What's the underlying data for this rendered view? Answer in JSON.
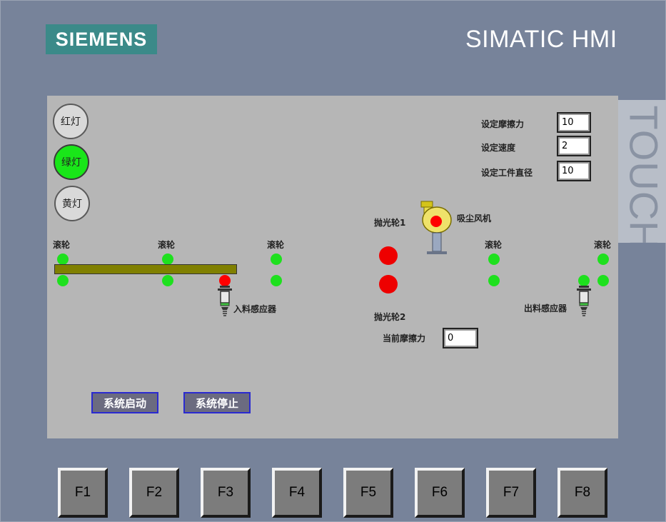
{
  "brand": {
    "logo": "SIEMENS",
    "title": "SIMATIC HMI",
    "touch": "TOUCH"
  },
  "lamps": {
    "red": "红灯",
    "green": "绿灯",
    "yellow": "黄灯"
  },
  "settings": {
    "friction_label": "设定摩擦力",
    "friction_value": "10",
    "speed_label": "设定速度",
    "speed_value": "2",
    "diameter_label": "设定工件直径",
    "diameter_value": "10"
  },
  "process": {
    "roller_label": "滚轮",
    "polish1": "抛光轮1",
    "polish2": "抛光轮2",
    "fan": "吸尘风机",
    "in_sensor": "入料感应器",
    "out_sensor": "出料感应器",
    "current_friction_label": "当前摩擦力",
    "current_friction_value": "0"
  },
  "buttons": {
    "start": "系统启动",
    "stop": "系统停止"
  },
  "fkeys": [
    "F1",
    "F2",
    "F3",
    "F4",
    "F5",
    "F6",
    "F7",
    "F8"
  ],
  "colors": {
    "lamp_on": "#19e619",
    "roller_on": "#1ee01e",
    "alarm": "#ff0000",
    "belt": "#808000"
  }
}
